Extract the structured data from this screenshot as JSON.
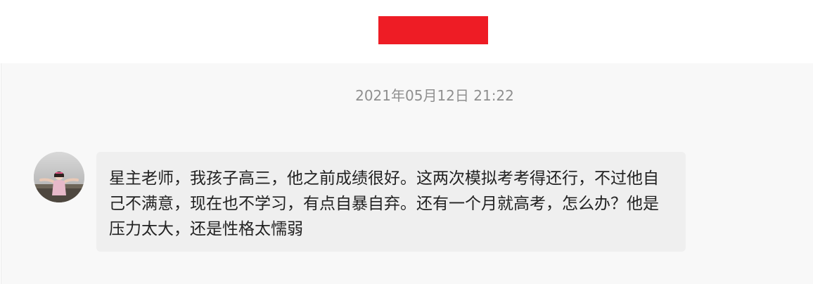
{
  "header": {
    "redacted_color": "#ee1c25"
  },
  "chat": {
    "timestamp": "2021年05月12日 21:22",
    "messages": [
      {
        "avatar_icon": "user-avatar-photo",
        "text": "星主老师，我孩子高三，他之前成绩很好。这两次模拟考考得还行，不过他自己不满意，现在也不学习，有点自暴自弃。还有一个月就高考，怎么办？他是压力太大，还是性格太懦弱"
      }
    ]
  }
}
